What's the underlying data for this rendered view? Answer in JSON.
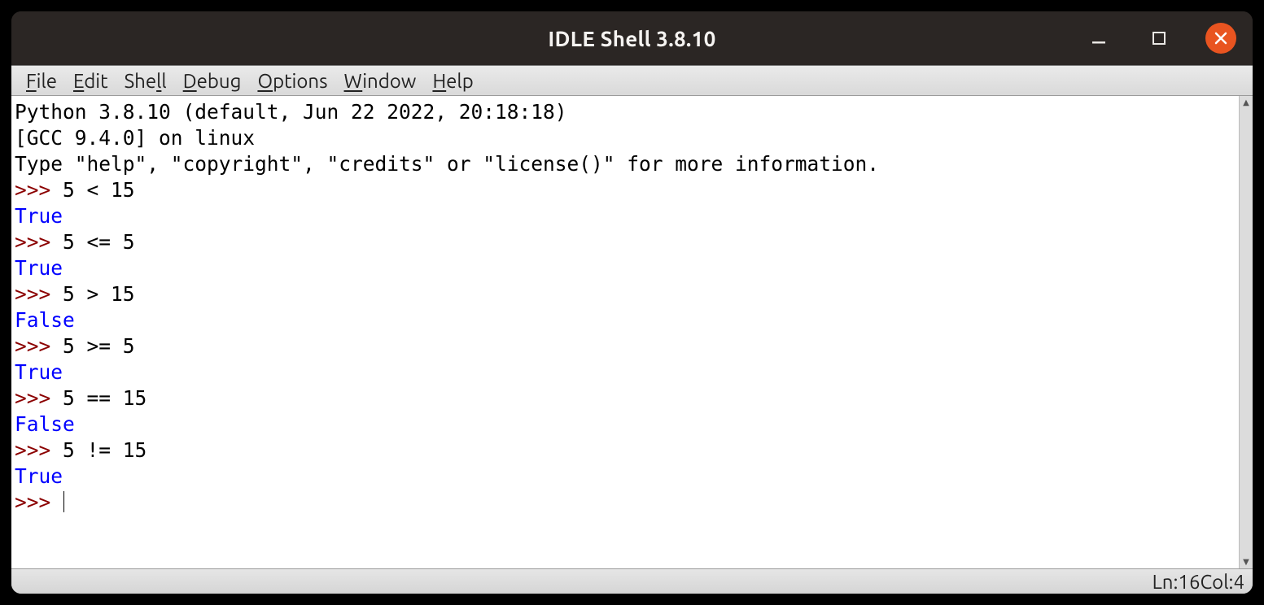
{
  "window": {
    "title": "IDLE Shell 3.8.10"
  },
  "menubar": {
    "items": [
      "File",
      "Edit",
      "Shell",
      "Debug",
      "Options",
      "Window",
      "Help"
    ]
  },
  "shell": {
    "banner": [
      "Python 3.8.10 (default, Jun 22 2022, 20:18:18) ",
      "[GCC 9.4.0] on linux",
      "Type \"help\", \"copyright\", \"credits\" or \"license()\" for more information."
    ],
    "prompt": ">>> ",
    "sessions": [
      {
        "input": "5 < 15",
        "output": "True"
      },
      {
        "input": "5 <= 5",
        "output": "True"
      },
      {
        "input": "5 > 15",
        "output": "False"
      },
      {
        "input": "5 >= 5",
        "output": "True"
      },
      {
        "input": "5 == 15",
        "output": "False"
      },
      {
        "input": "5 != 15",
        "output": "True"
      }
    ]
  },
  "status": {
    "line_label": "Ln: ",
    "line": "16",
    "col_label": " Col: ",
    "col": "4"
  }
}
